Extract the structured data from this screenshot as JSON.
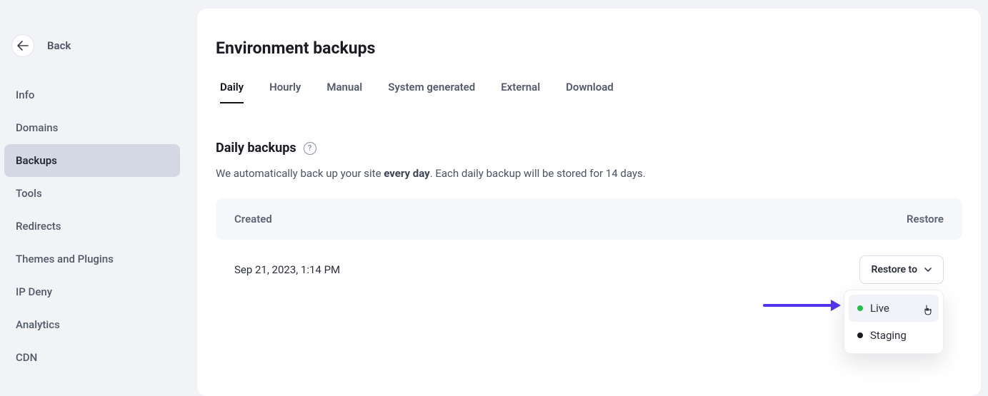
{
  "sidebar": {
    "back_label": "Back",
    "items": [
      {
        "label": "Info",
        "active": false
      },
      {
        "label": "Domains",
        "active": false
      },
      {
        "label": "Backups",
        "active": true
      },
      {
        "label": "Tools",
        "active": false
      },
      {
        "label": "Redirects",
        "active": false
      },
      {
        "label": "Themes and Plugins",
        "active": false
      },
      {
        "label": "IP Deny",
        "active": false
      },
      {
        "label": "Analytics",
        "active": false
      },
      {
        "label": "CDN",
        "active": false
      }
    ]
  },
  "main": {
    "title": "Environment backups",
    "tabs": [
      {
        "label": "Daily",
        "active": true
      },
      {
        "label": "Hourly",
        "active": false
      },
      {
        "label": "Manual",
        "active": false
      },
      {
        "label": "System generated",
        "active": false
      },
      {
        "label": "External",
        "active": false
      },
      {
        "label": "Download",
        "active": false
      }
    ],
    "section": {
      "heading": "Daily backups",
      "desc_before": "We automatically back up your site ",
      "desc_bold": "every day",
      "desc_after": ". Each daily backup will be stored for 14 days."
    },
    "table": {
      "headers": {
        "created": "Created",
        "restore": "Restore"
      },
      "rows": [
        {
          "created": "Sep 21, 2023, 1:14 PM",
          "restore_label": "Restore to"
        }
      ]
    },
    "dropdown": {
      "options": [
        {
          "label": "Live",
          "color": "green",
          "hover": true
        },
        {
          "label": "Staging",
          "color": "black",
          "hover": false
        }
      ]
    }
  }
}
